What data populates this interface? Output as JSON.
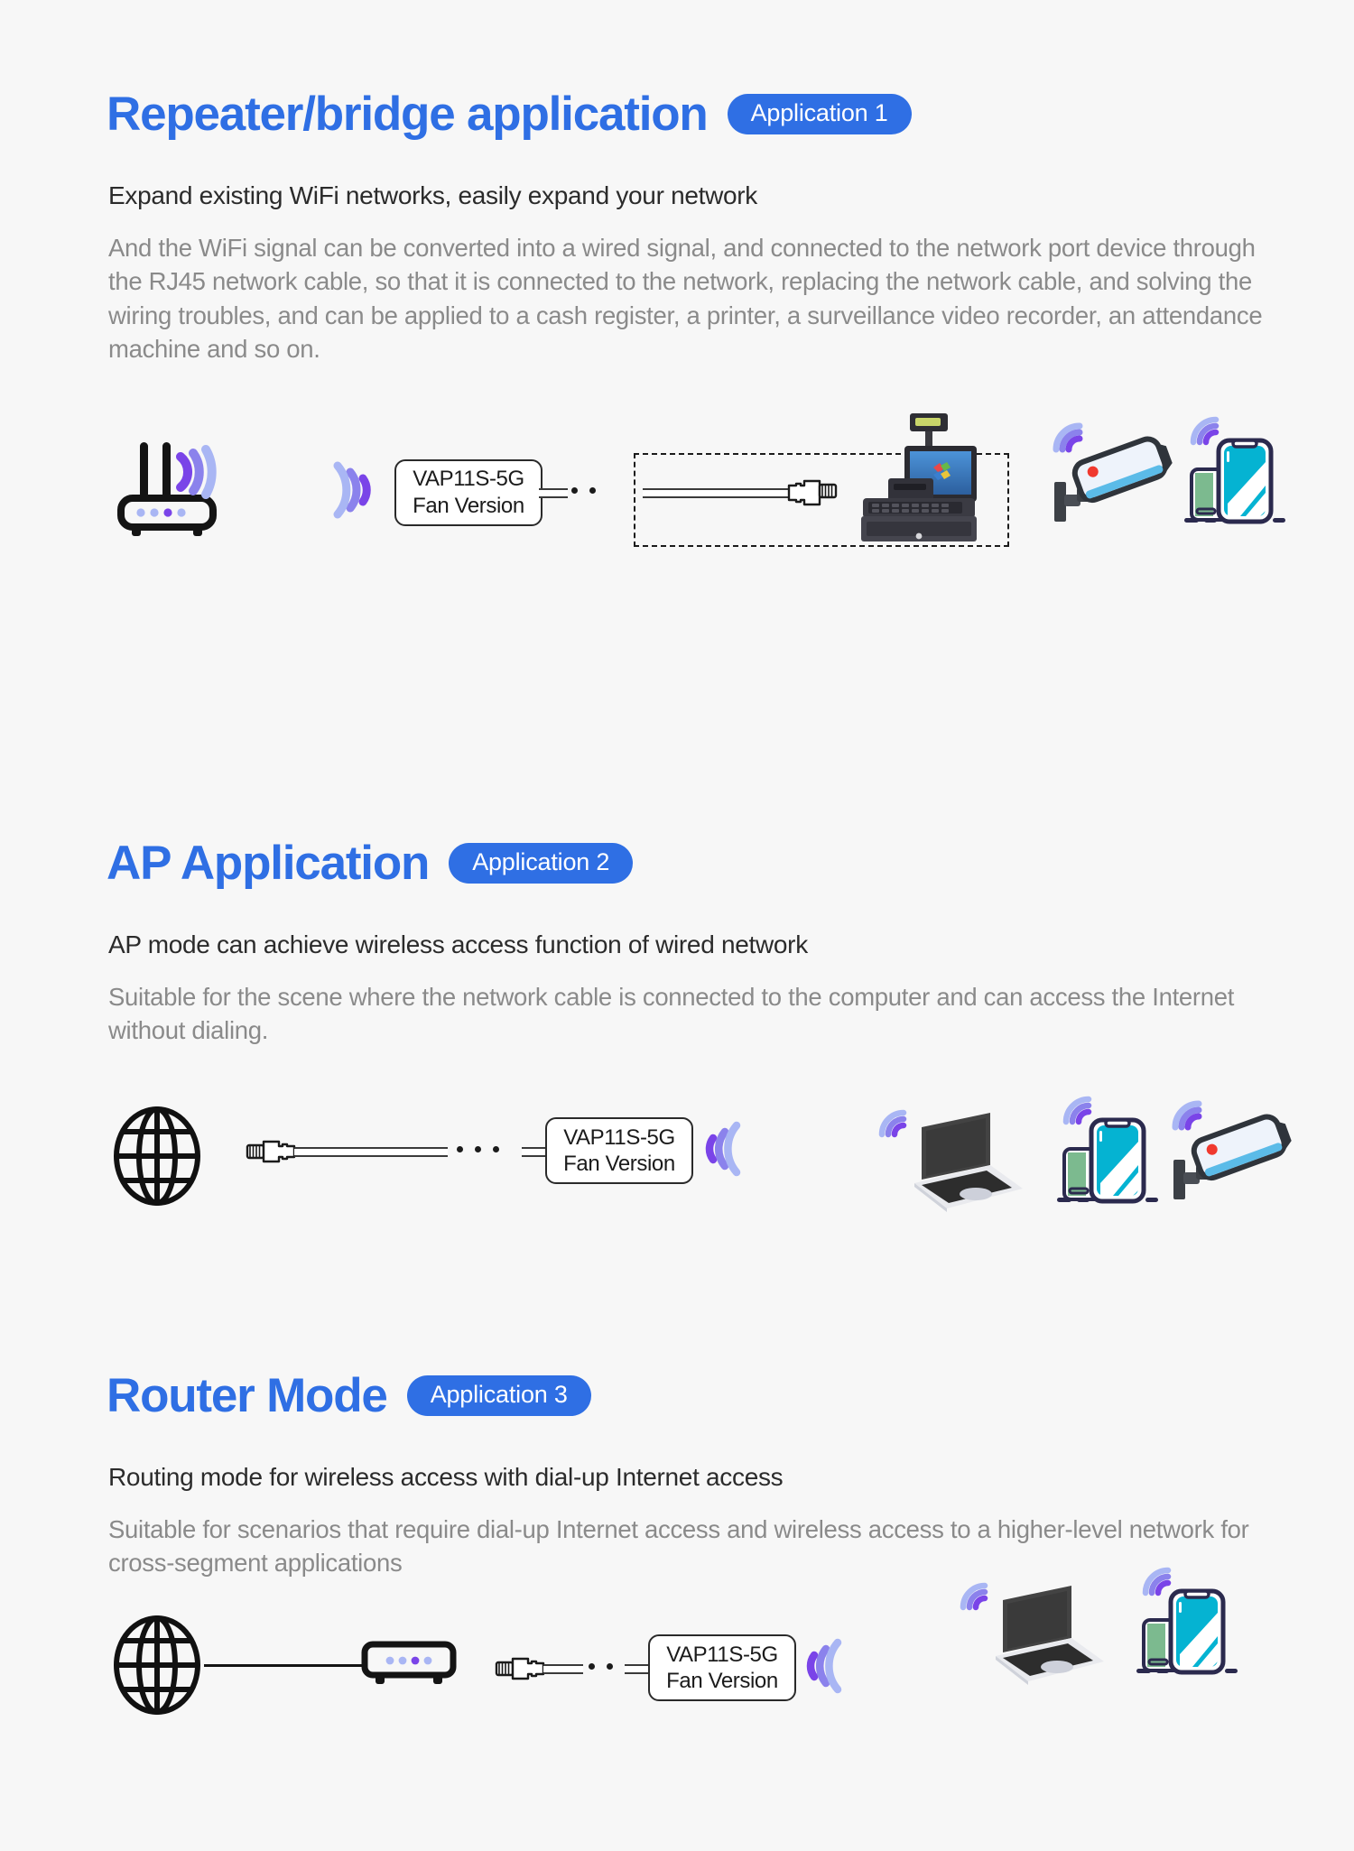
{
  "page": {
    "background_color": "#f7f7f7",
    "accent_color": "#2f6fe4",
    "heading_color": "#2f6fe4",
    "lead_color": "#2b2b2b",
    "body_color": "#8a8a8a",
    "wave_colors": [
      "#a9b6f4",
      "#8b82ec",
      "#7a44e8"
    ]
  },
  "sections": [
    {
      "id": "repeater",
      "title": "Repeater/bridge application",
      "badge": "Application 1",
      "lead": "Expand existing WiFi networks,  easily expand your network",
      "body": "And the WiFi signal can be converted into a wired signal, and connected to the network port device through the RJ45 network cable, so that it is connected to the network, replacing the network cable, and solving the wiring troubles, and can be applied to a cash register, a printer, a surveillance video recorder, an attendance machine and so on.",
      "device_label_line1": "VAP11S-5G",
      "device_label_line2": "Fan Version",
      "icons": [
        "wifi-router-icon",
        "wifi-signal-icon",
        "vap-device-box",
        "rj45-cable-icon",
        "cash-register-icon",
        "security-camera-icon",
        "smartphone-icon"
      ]
    },
    {
      "id": "ap",
      "title": "AP Application",
      "badge": "Application 2",
      "lead": "AP mode can achieve wireless access function of wired network",
      "body": "Suitable for the scene where the network cable is connected to the computer and can access the Internet without dialing.",
      "device_label_line1": "VAP11S-5G",
      "device_label_line2": "Fan Version",
      "icons": [
        "globe-icon",
        "rj45-cable-icon",
        "vap-device-box",
        "wifi-signal-icon",
        "laptop-icon",
        "smartphone-icon",
        "security-camera-icon"
      ]
    },
    {
      "id": "router",
      "title": "Router Mode",
      "badge": "Application 3",
      "lead": "Routing mode for wireless access with dial-up Internet access",
      "body": "Suitable for scenarios that require dial-up Internet access and wireless access to a higher-level network for cross-segment applications",
      "device_label_line1": "VAP11S-5G",
      "device_label_line2": "Fan Version",
      "icons": [
        "globe-icon",
        "modem-icon",
        "rj45-cable-icon",
        "vap-device-box",
        "wifi-signal-icon",
        "laptop-icon",
        "smartphone-icon"
      ]
    }
  ]
}
